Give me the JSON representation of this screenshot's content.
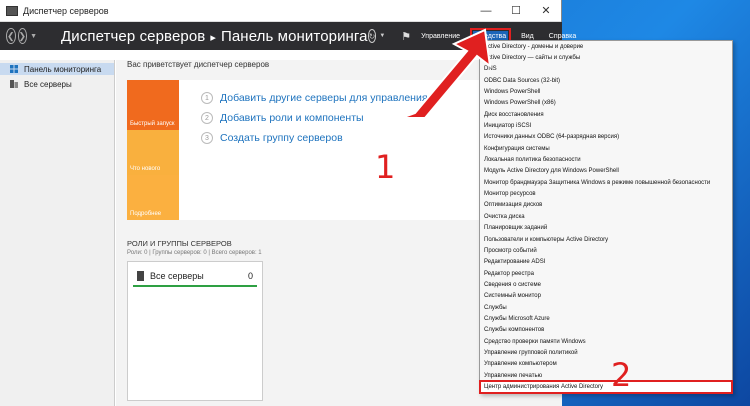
{
  "window": {
    "title": "Диспетчер серверов"
  },
  "toolbar": {
    "breadcrumb_root": "Диспетчер серверов",
    "breadcrumb_page": "Панель мониторинга",
    "menu": [
      "Управление",
      "Средства",
      "Вид",
      "Справка"
    ]
  },
  "sidebar": {
    "items": [
      "Панель мониторинга",
      "Все серверы"
    ]
  },
  "welcome": {
    "title": "Вас приветствует диспетчер серверов",
    "tiles": [
      "Быстрый запуск",
      "Что нового",
      "Подробнее"
    ],
    "steps": [
      {
        "num": "1",
        "label": "Добавить другие серверы для управления"
      },
      {
        "num": "2",
        "label": "Добавить роли и компоненты"
      },
      {
        "num": "3",
        "label": "Создать группу серверов"
      }
    ]
  },
  "roles": {
    "title": "РОЛИ И ГРУППЫ СЕРВЕРОВ",
    "subtitle": "Роли: 0 | Группы серверов: 0 | Всего серверов: 1",
    "card_label": "Все серверы",
    "card_count": "0"
  },
  "tools_menu": [
    "Active Directory - домены и доверие",
    "Active Directory — сайты и службы",
    "DNS",
    "ODBC Data Sources (32-bit)",
    "Windows PowerShell",
    "Windows PowerShell (x86)",
    "Диск восстановления",
    "Инициатор iSCSI",
    "Источники данных ODBC (64-разрядная версия)",
    "Конфигурация системы",
    "Локальная политика безопасности",
    "Модуль Active Directory для Windows PowerShell",
    "Монитор брандмауэра Защитника Windows в режиме повышенной безопасности",
    "Монитор ресурсов",
    "Оптимизация дисков",
    "Очистка диска",
    "Планировщик заданий",
    "Пользователи и компьютеры Active Directory",
    "Просмотр событий",
    "Редактирование ADSI",
    "Редактор реестра",
    "Сведения о системе",
    "Системный монитор",
    "Службы",
    "Службы Microsoft Azure",
    "Службы компонентов",
    "Средство проверки памяти Windows",
    "Управление групповой политикой",
    "Управление компьютером",
    "Управление печатью",
    "Центр администрирования Active Directory"
  ],
  "annotations": [
    "1",
    "2"
  ],
  "colors": {
    "accent": "#1e73be",
    "annotation": "#e02020",
    "tile_quick": "#f06a1e",
    "tile_other": "#f9b03e",
    "toolbar": "#2d2d30"
  }
}
